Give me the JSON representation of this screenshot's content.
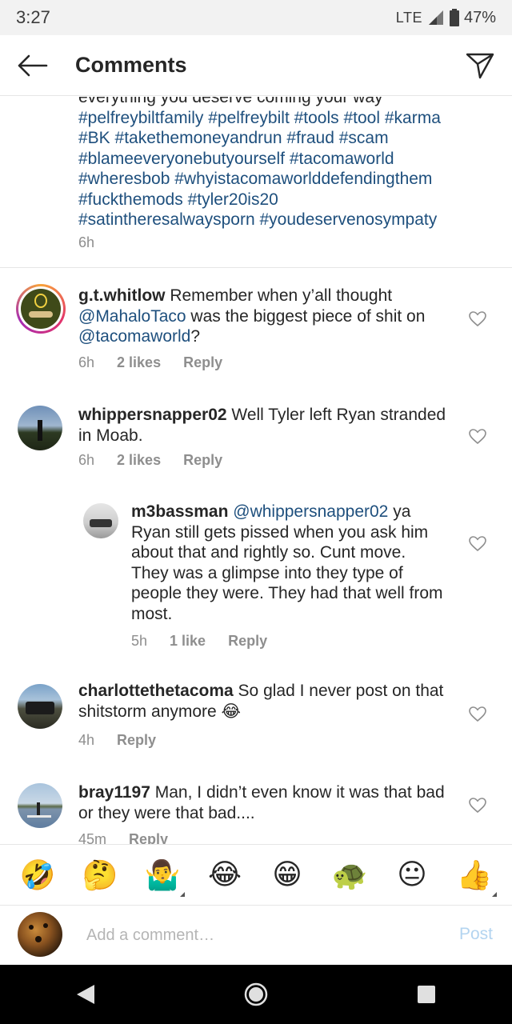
{
  "status": {
    "time": "3:27",
    "network": "LTE",
    "battery": "47%"
  },
  "header": {
    "title": "Comments",
    "back_icon": "arrow-left-icon",
    "send_icon": "paper-plane-icon"
  },
  "caption": {
    "line1": "everything you deserve coming your way",
    "tags_line2": "#pelfreybiltfamily #pelfreybilt #tools #tool #karma",
    "tags_line3": "#BK #takethemoneyandrun #fraud #scam",
    "tags_line4": "#blameeveryonebutyourself #tacomaworld",
    "tags_line5": "#wheresbob #whyistacomaworlddefendingthem",
    "tags_line6": "#fuckthemods #tyler20is20",
    "tags_line7": "#satintheresalwaysporn #youdeservenosympaty",
    "time": "6h"
  },
  "comments": [
    {
      "username": "g.t.whitlow",
      "t1": " Remember when y’all thought",
      "m1": "@MahaloTaco",
      "t2": " was the biggest piece of shit on",
      "m2": "@tacomaworld",
      "t3": "?",
      "time": "6h",
      "likes": "2 likes",
      "reply": "Reply"
    },
    {
      "username": "whippersnapper02",
      "t1": " Well Tyler left Ryan stranded in Moab.",
      "time": "6h",
      "likes": "2 likes",
      "reply": "Reply"
    },
    {
      "username": "m3bassman",
      "m1": "@whippersnapper02",
      "t1": " ya Ryan still gets pissed when you ask him about that and rightly so. Cunt move. They was a glimpse into they type of people they were. They had that well from most.",
      "time": "5h",
      "likes": "1 like",
      "reply": "Reply"
    },
    {
      "username": "charlottethetacoma",
      "t1": " So glad I never post on that shitstorm anymore 😂",
      "time": "4h",
      "reply": "Reply"
    },
    {
      "username": "bray1197",
      "t1": " Man, I didn’t even know it was that bad or they were that bad....",
      "time": "45m",
      "reply": "Reply"
    }
  ],
  "emoji_bar": [
    "🤣",
    "🤔",
    "🤷‍♂️",
    "😂",
    "😁",
    "🐢",
    "😐",
    "👍"
  ],
  "input": {
    "placeholder": "Add a comment…",
    "post_label": "Post"
  },
  "colors": {
    "link": "#1e4f7d",
    "muted": "#8e8e8e",
    "post": "#b3d4f0"
  }
}
